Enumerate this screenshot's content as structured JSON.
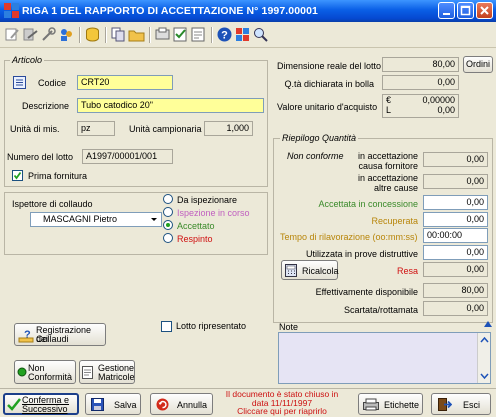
{
  "window": {
    "title": "RIGA 1 DEL RAPPORTO DI ACCETTAZIONE N° 1997.00001"
  },
  "articolo": {
    "section": "Articolo",
    "codice_label": "Codice",
    "codice": "CRT20",
    "descrizione_label": "Descrizione",
    "descrizione": "Tubo catodico 20\"",
    "um_label": "Unità di mis.",
    "um": "pz",
    "unita_camp_label": "Unità campionaria",
    "unita_camp": "1,000",
    "lotto_label": "Numero del lotto",
    "lotto": "A1997/00001/001",
    "prima_fornitura_label": "Prima fornitura",
    "prima_fornitura": true
  },
  "collaudo": {
    "ispettore_label": "Ispettore di collaudo",
    "ispettore": "MASCAGNI Pietro",
    "options": [
      "Da ispezionare",
      "Ispezione in corso",
      "Accettato",
      "Respinto"
    ],
    "selected": "Accettato"
  },
  "lotto_info": {
    "dimensione_label": "Dimensione reale del lotto",
    "dimensione": "80,00",
    "ordini_button": "Ordini",
    "qta_bolla_label": "Q.tà dichiarata in bolla",
    "qta_bolla": "0,00",
    "valore_label": "Valore unitario d'acquisto",
    "valore_eur": "0,00000",
    "valore_lire": "0,00",
    "currency_eur": "€",
    "currency_lire": "L"
  },
  "riepilogo": {
    "section": "Riepilogo Quantità",
    "non_conforme_label": "Non conforme",
    "causa_fornitore_label": [
      "in accettazione",
      "causa fornitore"
    ],
    "causa_fornitore": "0,00",
    "altre_cause_label": [
      "in accettazione",
      "altre cause"
    ],
    "altre_cause": "0,00",
    "concessione_label": "Accettata in concessione",
    "concessione": "0,00",
    "recuperata_label": "Recuperata",
    "recuperata": "0,00",
    "tempo_label": "Tempo di rilavorazione (oo:mm:ss)",
    "tempo": "00:00:00",
    "prove_label": "Utilizzata in prove distruttive",
    "prove": "0,00",
    "ricalcola_button": "Ricalcola",
    "resa_label": "Resa",
    "resa": "0,00",
    "disponibile_label": "Effettivamente disponibile",
    "disponibile": "80,00",
    "scartata_label": "Scartata/rottamata",
    "scartata": "0,00"
  },
  "lower": {
    "registrazione_button": [
      "Registrazione dei",
      "Collaudi"
    ],
    "lotto_ripresentato_label": "Lotto ripresentato",
    "non_conformita_button": [
      "Non",
      "Conformità"
    ],
    "gestione_matricole_button": [
      "Gestione",
      "Matricole"
    ],
    "note_label": "Note"
  },
  "bottom": {
    "conferma_button": [
      "Conferma e",
      "Successivo"
    ],
    "salva_button": "Salva",
    "annulla_button": "Annulla",
    "closed_message": [
      "Il documento è stato chiuso in",
      "data 11/11/1997",
      "Cliccare qui per riaprirlo"
    ],
    "etichette_button": "Etichette",
    "esci_button": "Esci"
  }
}
